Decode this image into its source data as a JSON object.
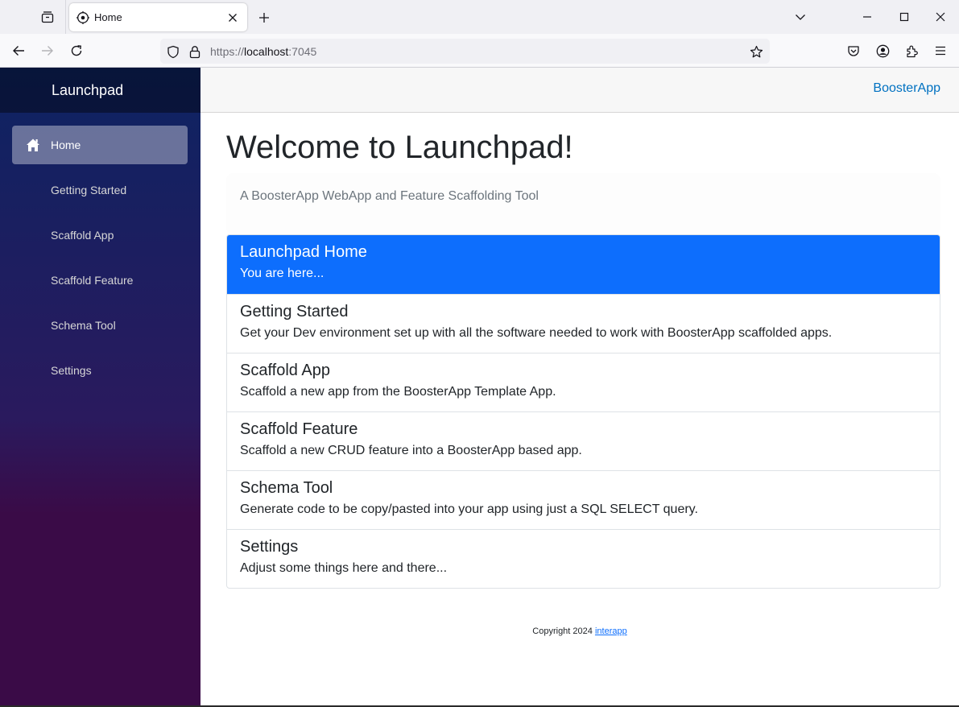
{
  "browser": {
    "tab_title": "Home",
    "url_prefix": "https://",
    "url_host": "localhost",
    "url_suffix": ":7045",
    "icons": {
      "tab_list": "tab-list-icon",
      "favicon": "target-icon",
      "tab_close": "close-icon",
      "new_tab": "plus-icon",
      "list_all_tabs": "chevron-down-icon",
      "minimize": "minimize-icon",
      "maximize": "maximize-icon",
      "close_window": "close-icon",
      "back": "arrow-left-icon",
      "forward": "arrow-right-icon",
      "reload": "reload-icon",
      "tracking_protection": "shield-icon",
      "lock": "lock-icon",
      "bookmark": "star-icon",
      "pocket": "pocket-icon",
      "account": "account-icon",
      "extensions": "puzzle-icon",
      "menu": "hamburger-icon"
    }
  },
  "sidebar": {
    "brand": "Launchpad",
    "items": [
      {
        "label": "Home",
        "icon": "home-icon",
        "active": true
      },
      {
        "label": "Getting Started",
        "active": false
      },
      {
        "label": "Scaffold App",
        "active": false
      },
      {
        "label": "Scaffold Feature",
        "active": false
      },
      {
        "label": "Schema Tool",
        "active": false
      },
      {
        "label": "Settings",
        "active": false
      }
    ]
  },
  "topbar": {
    "link": "BoosterApp"
  },
  "main": {
    "title": "Welcome to Launchpad!",
    "lead": "A BoosterApp WebApp and Feature Scaffolding Tool",
    "list": [
      {
        "title": "Launchpad Home",
        "description": "You are here...",
        "active": true
      },
      {
        "title": "Getting Started",
        "description": "Get your Dev environment set up with all the software needed to work with BoosterApp scaffolded apps."
      },
      {
        "title": "Scaffold App",
        "description": "Scaffold a new app from the BoosterApp Template App."
      },
      {
        "title": "Scaffold Feature",
        "description": "Scaffold a new CRUD feature into a BoosterApp based app."
      },
      {
        "title": "Schema Tool",
        "description": "Generate code to be copy/pasted into your app using just a SQL SELECT query."
      },
      {
        "title": "Settings",
        "description": "Adjust some things here and there..."
      }
    ]
  },
  "footer": {
    "text": "Copyright 2024",
    "link": "interapp"
  },
  "colors": {
    "active_list_item": "#0d6efd",
    "topbar_link": "#0071c1",
    "sidebar_top": "#0d2362",
    "sidebar_bottom": "#3a0b47"
  }
}
